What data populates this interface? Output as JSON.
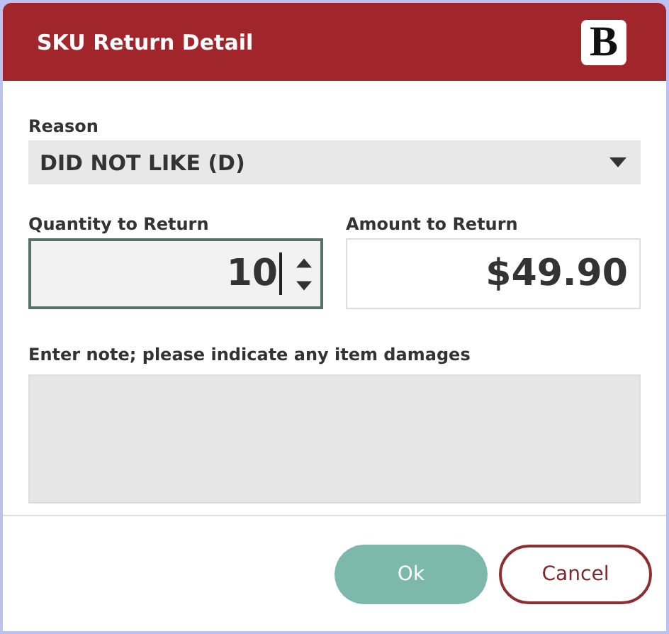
{
  "dialog": {
    "title": "SKU Return Detail",
    "logo": "B"
  },
  "reason": {
    "label": "Reason",
    "value": "DID NOT LIKE (D)"
  },
  "quantity": {
    "label": "Quantity to Return",
    "value": "10"
  },
  "amount": {
    "label": "Amount to Return",
    "value": "$49.90"
  },
  "note": {
    "label": "Enter note; please indicate any item damages"
  },
  "buttons": [
    {
      "label": "Ok",
      "kind": "primary"
    },
    {
      "label": "Cancel",
      "kind": "secondary"
    }
  ]
}
